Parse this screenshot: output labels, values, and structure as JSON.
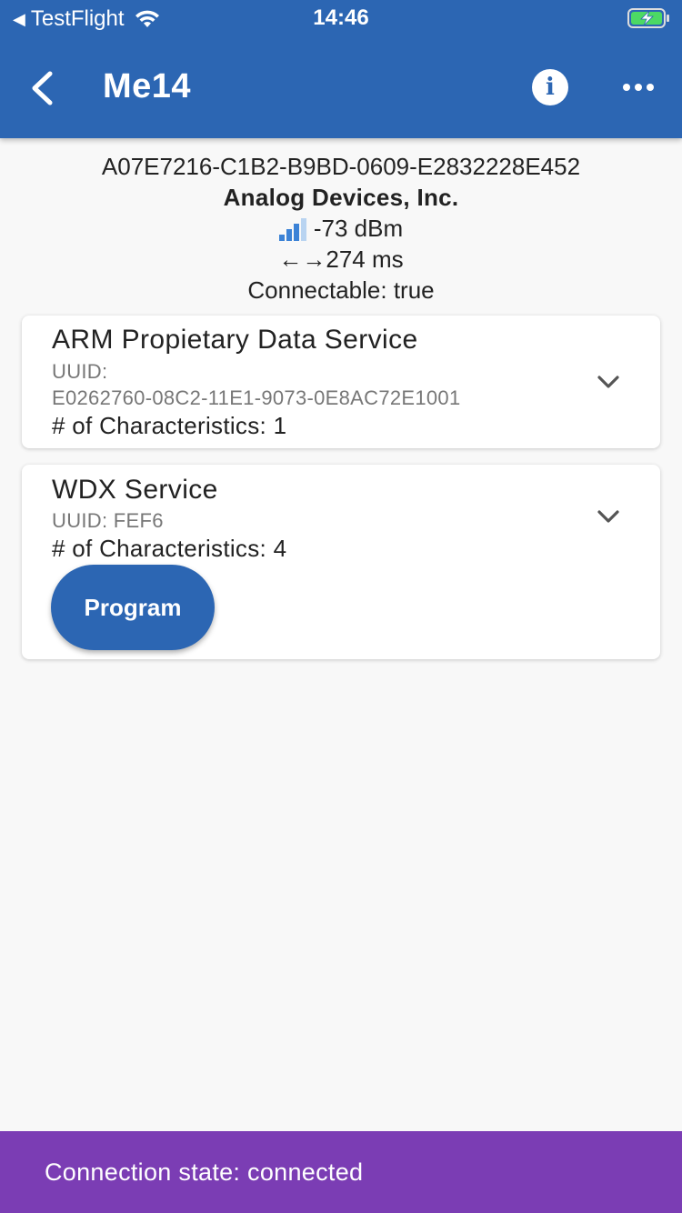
{
  "status_bar": {
    "back_app": "TestFlight",
    "time": "14:46",
    "icons": [
      "back-triangle-icon",
      "wifi-icon",
      "battery-charging-icon"
    ]
  },
  "app_bar": {
    "title": "Me14",
    "icons": [
      "chevron-left-icon",
      "info-icon",
      "more-horizontal-icon"
    ]
  },
  "device": {
    "id": "A07E7216-C1B2-B9BD-0609-E2832228E452",
    "manufacturer": "Analog Devices, Inc.",
    "rssi": "-73 dBm",
    "signal_level": 0.75,
    "interval": "274 ms",
    "interval_icon": "←→",
    "connectable": "Connectable: true"
  },
  "services": [
    {
      "name": "ARM Propietary Data Service",
      "uuid_label": "UUID:",
      "uuid": "E0262760-08C2-11E1-9073-0E8AC72E1001",
      "characteristics": "# of Characteristics: 1"
    },
    {
      "name": "WDX Service",
      "uuid": "UUID: FEF6",
      "characteristics": "# of Characteristics: 4",
      "button": "Program"
    }
  ],
  "connection": {
    "text": "Connection state: connected"
  },
  "colors": {
    "primary": "#2c66b3",
    "connection_bar": "#7b3db4",
    "signal_active": "#3b82d6",
    "signal_inactive": "#b9d4f1"
  }
}
